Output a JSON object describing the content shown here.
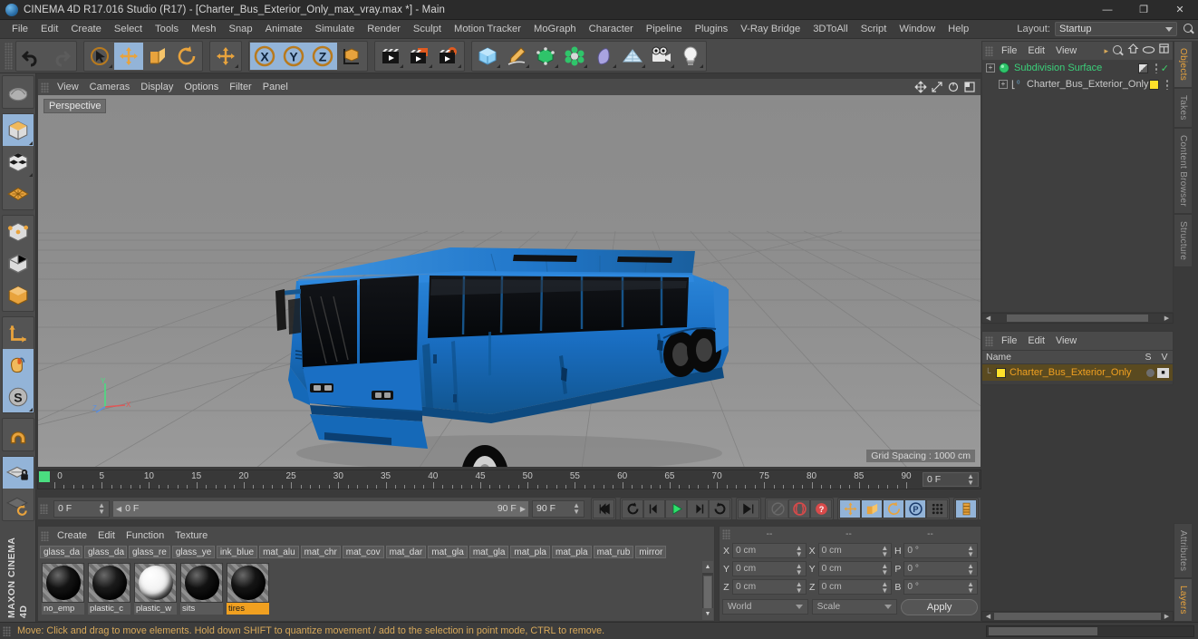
{
  "window": {
    "title": "CINEMA 4D R17.016 Studio (R17) - [Charter_Bus_Exterior_Only_max_vray.max *] - Main",
    "minimize": "—",
    "maximize": "❐",
    "close": "✕"
  },
  "menubar": {
    "items": [
      "File",
      "Edit",
      "Create",
      "Select",
      "Tools",
      "Mesh",
      "Snap",
      "Animate",
      "Simulate",
      "Render",
      "Sculpt",
      "Motion Tracker",
      "MoGraph",
      "Character",
      "Pipeline",
      "Plugins",
      "V-Ray Bridge",
      "3DToAll",
      "Script",
      "Window",
      "Help"
    ],
    "layout_label": "Layout:",
    "layout_value": "Startup",
    "search_icon": "search-icon"
  },
  "toolbar": {
    "groups": [
      {
        "name": "undo-redo",
        "buttons": [
          {
            "icon": "undo-icon",
            "selected": false,
            "disabled": false
          },
          {
            "icon": "redo-icon",
            "selected": false,
            "disabled": true
          }
        ]
      },
      {
        "name": "transform-tools",
        "buttons": [
          {
            "icon": "select-live-icon",
            "selected": false,
            "disabled": false,
            "corner": true
          },
          {
            "icon": "move-icon",
            "selected": true,
            "disabled": false
          },
          {
            "icon": "scale-icon",
            "selected": false,
            "disabled": false
          },
          {
            "icon": "rotate-icon",
            "selected": false,
            "disabled": false
          }
        ]
      },
      {
        "name": "move-dup",
        "buttons": [
          {
            "icon": "move-icon",
            "selected": false,
            "disabled": false,
            "corner": true
          }
        ]
      },
      {
        "name": "axis-locks",
        "buttons": [
          {
            "icon": "x-axis-icon",
            "selected": true,
            "disabled": false
          },
          {
            "icon": "y-axis-icon",
            "selected": true,
            "disabled": false
          },
          {
            "icon": "z-axis-icon",
            "selected": true,
            "disabled": false
          },
          {
            "icon": "world-object-axis-icon",
            "selected": false,
            "disabled": false
          }
        ]
      },
      {
        "name": "render-tools",
        "buttons": [
          {
            "icon": "render-view-icon",
            "selected": false,
            "disabled": false,
            "corner": true
          },
          {
            "icon": "render-to-picture-viewer-icon",
            "selected": false,
            "disabled": false,
            "corner": true
          },
          {
            "icon": "render-settings-icon",
            "selected": false,
            "disabled": false,
            "corner": true
          }
        ]
      },
      {
        "name": "create-objects",
        "buttons": [
          {
            "icon": "cube-primitive-icon",
            "selected": false,
            "disabled": false,
            "corner": true
          },
          {
            "icon": "spline-pen-icon",
            "selected": false,
            "disabled": false,
            "corner": true
          },
          {
            "icon": "nurbs-generator-icon",
            "selected": false,
            "disabled": false,
            "corner": true
          },
          {
            "icon": "array-modeling-icon",
            "selected": false,
            "disabled": false,
            "corner": true
          },
          {
            "icon": "deformer-icon",
            "selected": false,
            "disabled": false,
            "corner": true
          },
          {
            "icon": "environment-floor-icon",
            "selected": false,
            "disabled": false,
            "corner": true
          },
          {
            "icon": "camera-icon",
            "selected": false,
            "disabled": false,
            "corner": true
          },
          {
            "icon": "light-icon",
            "selected": false,
            "disabled": false,
            "corner": true
          }
        ]
      }
    ]
  },
  "leftbar": {
    "groups": [
      {
        "buttons": [
          {
            "icon": "undo-view-icon",
            "selected": false
          }
        ]
      },
      {
        "buttons": [
          {
            "icon": "model-mode-icon",
            "selected": true,
            "corner": true
          },
          {
            "icon": "texture-mode-icon",
            "selected": false,
            "corner": true
          },
          {
            "icon": "workplane-mode-icon",
            "selected": false
          }
        ]
      },
      {
        "buttons": [
          {
            "icon": "points-mode-icon",
            "selected": false
          },
          {
            "icon": "edges-mode-icon",
            "selected": false
          },
          {
            "icon": "polygons-mode-icon",
            "selected": false
          }
        ]
      },
      {
        "buttons": [
          {
            "icon": "axis-modification-icon",
            "selected": false
          },
          {
            "icon": "enable-viewport-solo-icon",
            "selected": true
          },
          {
            "icon": "snapping-icon",
            "selected": true,
            "corner": true
          }
        ]
      },
      {
        "buttons": [
          {
            "icon": "magnet-icon",
            "selected": false
          }
        ]
      },
      {
        "buttons": [
          {
            "icon": "workplane-lock-icon",
            "selected": true
          },
          {
            "icon": "planar-workplane-icon",
            "selected": false
          }
        ]
      }
    ],
    "brand_line1": "MAXON",
    "brand_line2": "CINEMA 4D"
  },
  "viewport": {
    "menu": [
      "View",
      "Cameras",
      "Display",
      "Options",
      "Filter",
      "Panel"
    ],
    "nav_icons": [
      "move-view-icon",
      "scale-view-icon",
      "rotate-view-icon",
      "maximize-viewport-icon"
    ],
    "label": "Perspective",
    "grid_spacing": "Grid Spacing : 1000 cm",
    "axis_y_label": "Y",
    "axis_x_label": "X",
    "axis_z_label": "Z"
  },
  "object_manager": {
    "menu": [
      "File",
      "Edit",
      "View"
    ],
    "overflow_icon": "chevron-right-icon",
    "header_icons": [
      "search-icon",
      "home-icon",
      "eye-icon",
      "filter-icon"
    ],
    "items": [
      {
        "name": "Subdivision Surface",
        "icon": "subdivision-surface-icon",
        "indent": 0,
        "color": "#3bd07a",
        "tag_color": "#808080",
        "check": true
      },
      {
        "name": "Charter_Bus_Exterior_Only",
        "icon": "null-object-icon",
        "indent": 1,
        "color": "#c9c9c9",
        "tag_color": "#ffe02a",
        "check": false
      }
    ]
  },
  "material_tags_panel": {
    "menu": [
      "File",
      "Edit",
      "View"
    ],
    "col_name": "Name",
    "col_s": "S",
    "col_v": "V",
    "rows": [
      {
        "name": "Charter_Bus_Exterior_Only",
        "swatch": "#ffe02a",
        "selected": true
      }
    ]
  },
  "side_tabs": {
    "upper": [
      "Objects",
      "Takes",
      "Content Browser",
      "Structure"
    ],
    "upper_active": "Objects",
    "lower": [
      "Attributes",
      "Layers"
    ],
    "lower_active": "Layers"
  },
  "timeline": {
    "ticks": [
      0,
      5,
      10,
      15,
      20,
      25,
      30,
      35,
      40,
      45,
      50,
      55,
      60,
      65,
      70,
      75,
      80,
      85,
      90
    ],
    "current_frame_field": "0 F",
    "marker_frame": 0
  },
  "playback": {
    "current_frame": "0 F",
    "range_start": "0 F",
    "range_end": "90 F",
    "end_frame_field": "90 F",
    "buttons": [
      {
        "icon": "go-to-start-icon",
        "selected": false
      },
      {
        "icon": "loop-previous-icon",
        "selected": false
      },
      {
        "icon": "step-back-icon",
        "selected": false
      },
      {
        "icon": "play-icon",
        "selected": false
      },
      {
        "icon": "step-forward-icon",
        "selected": false
      },
      {
        "icon": "loop-next-icon",
        "selected": false
      },
      {
        "icon": "go-to-end-icon",
        "selected": false
      }
    ],
    "record_buttons": [
      {
        "icon": "autokeying-icon",
        "selected": false,
        "disabled": true
      },
      {
        "icon": "record-active-objects-icon",
        "selected": false
      },
      {
        "icon": "keyframe-selection-icon",
        "selected": false
      }
    ],
    "key_toggles": [
      {
        "icon": "position-key-icon",
        "selected": true
      },
      {
        "icon": "scale-key-icon",
        "selected": true
      },
      {
        "icon": "rotation-key-icon",
        "selected": true
      },
      {
        "icon": "parameter-key-icon",
        "selected": true
      },
      {
        "icon": "point-level-animation-icon",
        "selected": false
      }
    ],
    "timeline_toggle": {
      "icon": "timeline-icon",
      "selected": true
    }
  },
  "material_manager": {
    "menu": [
      "Create",
      "Edit",
      "Function",
      "Texture"
    ],
    "name_chips": [
      "glass_da",
      "glass_da",
      "glass_re",
      "glass_ye",
      "ink_blue",
      "mat_alu",
      "mat_chr",
      "mat_cov",
      "mat_dar",
      "mat_gla",
      "mat_gla",
      "mat_pla",
      "mat_pla",
      "mat_rub",
      "mirror"
    ],
    "materials": [
      {
        "label": "no_emp",
        "sphere": "#141414",
        "selected": false
      },
      {
        "label": "plastic_c",
        "sphere": "#1b1b1b",
        "selected": false
      },
      {
        "label": "plastic_w",
        "sphere": "#f0f0f0",
        "selected": false
      },
      {
        "label": "sits",
        "sphere": "#121212",
        "selected": false
      },
      {
        "label": "tires",
        "sphere": "#151515",
        "selected": true
      }
    ]
  },
  "coordinates": {
    "col1_header": "--",
    "col2_header": "--",
    "col3_header": "--",
    "rows": [
      {
        "l1": "X",
        "v1": "0 cm",
        "l2": "X",
        "v2": "0 cm",
        "l3": "H",
        "v3": "0 °"
      },
      {
        "l1": "Y",
        "v1": "0 cm",
        "l2": "Y",
        "v2": "0 cm",
        "l3": "P",
        "v3": "0 °"
      },
      {
        "l1": "Z",
        "v1": "0 cm",
        "l2": "Z",
        "v2": "0 cm",
        "l3": "B",
        "v3": "0 °"
      }
    ],
    "system": "World",
    "mode": "Scale",
    "apply": "Apply"
  },
  "statusbar": {
    "text": "Move: Click and drag to move elements. Hold down SHIFT to quantize movement / add to the selection in point mode, CTRL to remove."
  },
  "colors": {
    "bus_body": "#1a6fc4",
    "bus_glass": "#0c0c0c",
    "accent_orange": "#f0a020",
    "highlight_blue": "#93b4d8"
  }
}
